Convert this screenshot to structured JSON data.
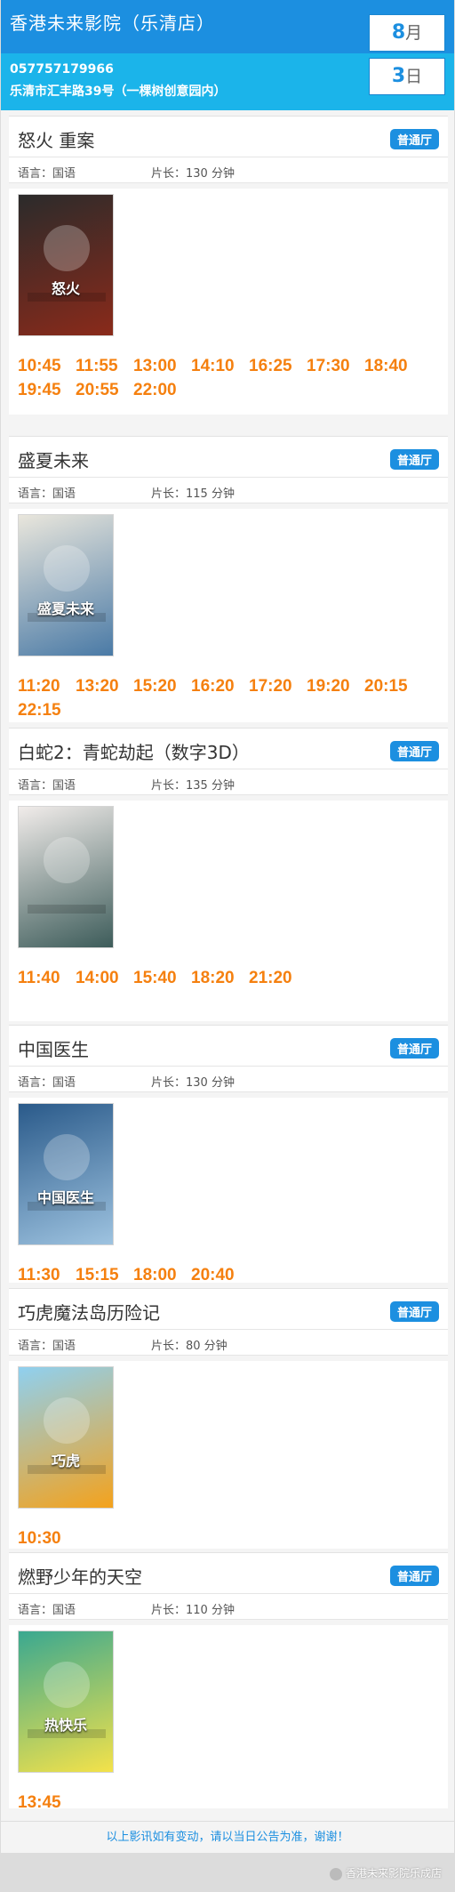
{
  "header": {
    "cinema_name": "香港未来影院（乐清店）",
    "month_num": "8",
    "month_unit": "月",
    "day_num": "3",
    "day_unit": "日",
    "phone": "057757179966",
    "address": "乐清市汇丰路39号（一棵树创意园内）"
  },
  "labels": {
    "language": "语言：国语",
    "hall": "普通厅"
  },
  "movies": [
    {
      "title": "怒火 重案",
      "length": "片长：130 分钟",
      "poster_text": "怒火",
      "poster_colors": [
        "#2b2b2b",
        "#8a2a1a"
      ],
      "times": [
        "10:45",
        "11:55",
        "13:00",
        "14:10",
        "16:25",
        "17:30",
        "18:40",
        "19:45",
        "20:55",
        "22:00"
      ]
    },
    {
      "title": "盛夏未来",
      "length": "片长：115 分钟",
      "poster_text": "盛夏未来",
      "poster_colors": [
        "#e9e6dc",
        "#4a7aa6"
      ],
      "times": [
        "11:20",
        "13:20",
        "15:20",
        "16:20",
        "17:20",
        "19:20",
        "20:15",
        "22:15"
      ]
    },
    {
      "title": "白蛇2：青蛇劫起（数字3D）",
      "length": "片长：135 分钟",
      "poster_text": "",
      "poster_colors": [
        "#f1ecea",
        "#3d5c5a"
      ],
      "times": [
        "11:40",
        "14:00",
        "15:40",
        "18:20",
        "21:20"
      ]
    },
    {
      "title": "中国医生",
      "length": "片长：130 分钟",
      "poster_text": "中国医生",
      "poster_colors": [
        "#2a5a8a",
        "#9ec3e0"
      ],
      "times": [
        "11:30",
        "15:15",
        "18:00",
        "20:40"
      ]
    },
    {
      "title": "巧虎魔法岛历险记",
      "length": "片长：80 分钟",
      "poster_text": "巧虎",
      "poster_colors": [
        "#8fd0f0",
        "#f4a21c"
      ],
      "times": [
        "10:30"
      ]
    },
    {
      "title": "燃野少年的天空",
      "length": "片长：110 分钟",
      "poster_text": "热快乐",
      "poster_colors": [
        "#3aa890",
        "#f4e24a"
      ],
      "times": [
        "13:45"
      ]
    }
  ],
  "footer": {
    "notice": "以上影讯如有变动，请以当日公告为准，谢谢！",
    "watermark": "香港未来影院乐成店"
  }
}
